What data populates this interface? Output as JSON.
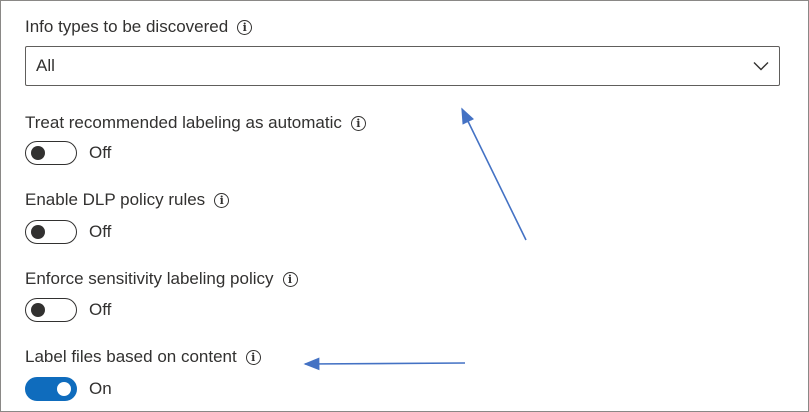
{
  "info_types": {
    "label": "Info types to be discovered",
    "selected": "All"
  },
  "settings": [
    {
      "label": "Treat recommended labeling as automatic",
      "state": "Off"
    },
    {
      "label": "Enable DLP policy rules",
      "state": "Off"
    },
    {
      "label": "Enforce sensitivity labeling policy",
      "state": "Off"
    },
    {
      "label": "Label files based on content",
      "state": "On"
    }
  ],
  "icons": {
    "info": "info-icon",
    "chevron": "chevron-down-icon"
  },
  "colors": {
    "toggle_on": "#0f6cbd",
    "annotation_arrow": "#4472c4"
  }
}
